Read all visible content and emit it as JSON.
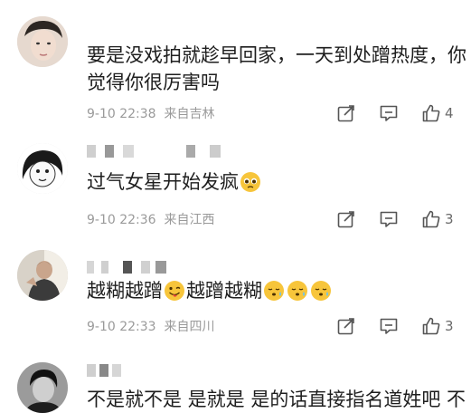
{
  "comments": [
    {
      "text_line1": "要是没戏拍就趁早回家，一天到处蹭热度，你",
      "text_line2": "觉得你很厉害吗",
      "time": "9-10 22:38",
      "location": "来自吉林",
      "likes": "4"
    },
    {
      "text": "过气女星开始发疯",
      "time": "9-10 22:36",
      "location": "来自江西",
      "likes": "3"
    },
    {
      "text_a": "越糊越蹭",
      "text_b": "越蹭越糊",
      "time": "9-10 22:33",
      "location": "来自四川",
      "likes": "3"
    },
    {
      "text": "不是就不是 是就是 是的话直接指名道姓吧 不"
    }
  ],
  "icons": {
    "share": "share-icon",
    "comment": "comment-icon",
    "like": "thumbs-up-icon",
    "emoji_pleading": "pleading-face-icon",
    "emoji_tongue": "winking-tongue-face-icon",
    "emoji_sleepy": "sleepy-face-icon"
  },
  "colors": {
    "text": "#1e1e1e",
    "meta": "#9a9a9a",
    "icon": "#555555",
    "emoji": "#f7c53b"
  }
}
